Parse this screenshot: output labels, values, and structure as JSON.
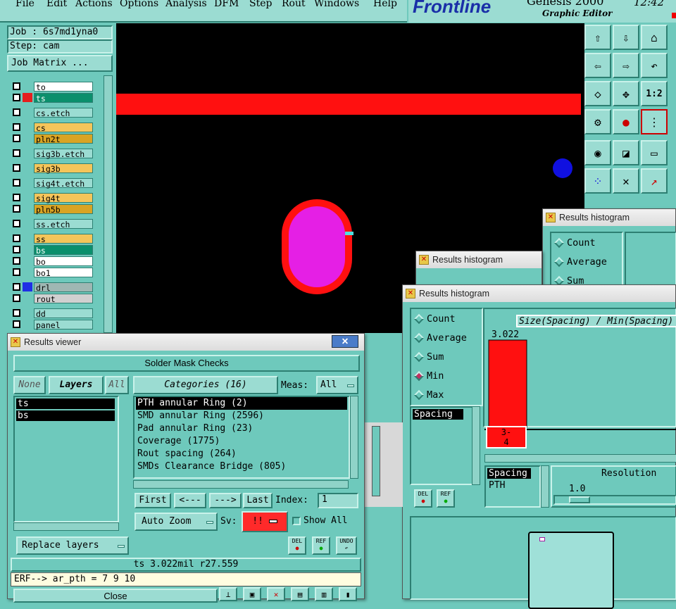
{
  "menubar": {
    "items": [
      "File",
      "Edit",
      "Actions",
      "Options",
      "Analysis",
      "DFM",
      "Step",
      "Rout",
      "Windows",
      "Help"
    ]
  },
  "logo": {
    "brand": "Frontline",
    "product": "Genesis 2000",
    "subtitle": "Graphic Editor",
    "clock": "12:42"
  },
  "job": {
    "job_label": "Job : 6s7md1yna0",
    "step_label": "Step: cam",
    "matrix_button": "Job Matrix ..."
  },
  "layers": [
    {
      "name": "to",
      "bg": "#ffffff",
      "sw": ""
    },
    {
      "name": "ts",
      "bg": "#0b8f6c",
      "sw": "#e51f1f"
    },
    {
      "name": "cs.etch",
      "bg": "#9bdcd2",
      "sw": ""
    },
    {
      "name": "cs",
      "bg": "#f5c55a",
      "sw": ""
    },
    {
      "name": "pln2t",
      "bg": "#d9a424",
      "sw": ""
    },
    {
      "name": "sig3b.etch",
      "bg": "#9bdcd2",
      "sw": ""
    },
    {
      "name": "sig3b",
      "bg": "#f5c55a",
      "sw": ""
    },
    {
      "name": "sig4t.etch",
      "bg": "#9bdcd2",
      "sw": ""
    },
    {
      "name": "sig4t",
      "bg": "#f5c55a",
      "sw": ""
    },
    {
      "name": "pln5b",
      "bg": "#d9a424",
      "sw": ""
    },
    {
      "name": "ss.etch",
      "bg": "#9bdcd2",
      "sw": ""
    },
    {
      "name": "ss",
      "bg": "#f5c55a",
      "sw": ""
    },
    {
      "name": "bs",
      "bg": "#0b8f6c",
      "sw": ""
    },
    {
      "name": "bo",
      "bg": "#ffffff",
      "sw": ""
    },
    {
      "name": "bo1",
      "bg": "#ffffff",
      "sw": ""
    },
    {
      "name": "drl",
      "bg": "#9fb7b3",
      "sw": "#1f2fe5"
    },
    {
      "name": "rout",
      "bg": "#d0d0d0",
      "sw": ""
    },
    {
      "name": "dd",
      "bg": "#9bdcd2",
      "sw": ""
    },
    {
      "name": "panel",
      "bg": "#9bdcd2",
      "sw": ""
    }
  ],
  "viewer": {
    "title": "Results viewer",
    "header": "Solder Mask Checks",
    "none_btn": "None",
    "layers_btn": "Layers",
    "all_btn": "All",
    "categories_btn": "Categories (16)",
    "meas_label": "Meas:",
    "meas_value": "All",
    "layer_list": [
      "ts",
      "bs"
    ],
    "categories": [
      "PTH annular Ring (2)",
      "SMD annular Ring (2596)",
      "Pad annular Ring (23)",
      "Coverage (1775)",
      "Rout spacing (264)",
      "SMDs Clearance Bridge (805)"
    ],
    "first_btn": "First",
    "prev_btn": "<---",
    "next_btn": "--->",
    "last_btn": "Last",
    "index_label": "Index:",
    "index_value": "1",
    "autozoom_btn": "Auto Zoom",
    "sv_label": "Sv:",
    "sv_value": "!!",
    "show_all": "Show All",
    "replace_btn": "Replace layers",
    "del": "DEL",
    "ref": "REF",
    "undo": "UNDO",
    "status": "ts 3.022mil  r27.559",
    "erf": "ERF--> ar_pth = 7 9 10",
    "close_btn": "Close"
  },
  "hist_front": {
    "title": "Results histogram",
    "options": [
      "Count",
      "Average",
      "Sum",
      "Min",
      "Max"
    ],
    "selected": "Min",
    "chart_title": "Size(Spacing) / Min(Spacing)",
    "bar_value": "3.022",
    "bar_label": "3-\n4",
    "list_left": [
      "Spacing"
    ],
    "list_right": [
      "Spacing",
      "PTH"
    ],
    "resolution_label": "Resolution",
    "resolution_value": "1.0",
    "del": "DEL",
    "ref": "REF"
  },
  "hist_mid": {
    "title": "Results histogram"
  },
  "hist_back": {
    "title": "Results histogram",
    "options": [
      "Count",
      "Average",
      "Sum"
    ]
  },
  "colors": {
    "canvas": "#000000",
    "pad_outer": "#ff1010",
    "pad_inner": "#e51fe5",
    "track": "#ff1010",
    "via": "#1010e0"
  },
  "chart_data": {
    "type": "bar",
    "title": "Size(Spacing) / Min(Spacing)",
    "categories": [
      "3-4"
    ],
    "values": [
      3.022
    ]
  }
}
